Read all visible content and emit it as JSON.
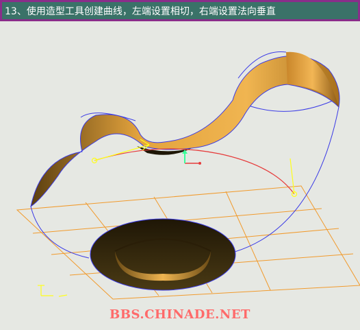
{
  "instruction": "13、使用造型工具创建曲线，左端设置相切，右端设置法向垂直",
  "watermark": "BBS.CHINADE.NET",
  "colors": {
    "header_bg": "#3a7268",
    "header_border": "#8a2d8a",
    "viewport_bg": "#e6e8e3",
    "surface_light": "#e3a33d",
    "surface_dark": "#3a2a0d",
    "grid": "#f19a2c",
    "blue_curve": "#3a3ae6",
    "red_curve": "#e63a3a",
    "handle_yellow": "#ffff1a",
    "axis_green": "#3aff9a"
  },
  "icons": [
    "coordinate-axis-icon",
    "tangent-handle-icon",
    "normal-handle-icon",
    "datum-triad-icon"
  ]
}
